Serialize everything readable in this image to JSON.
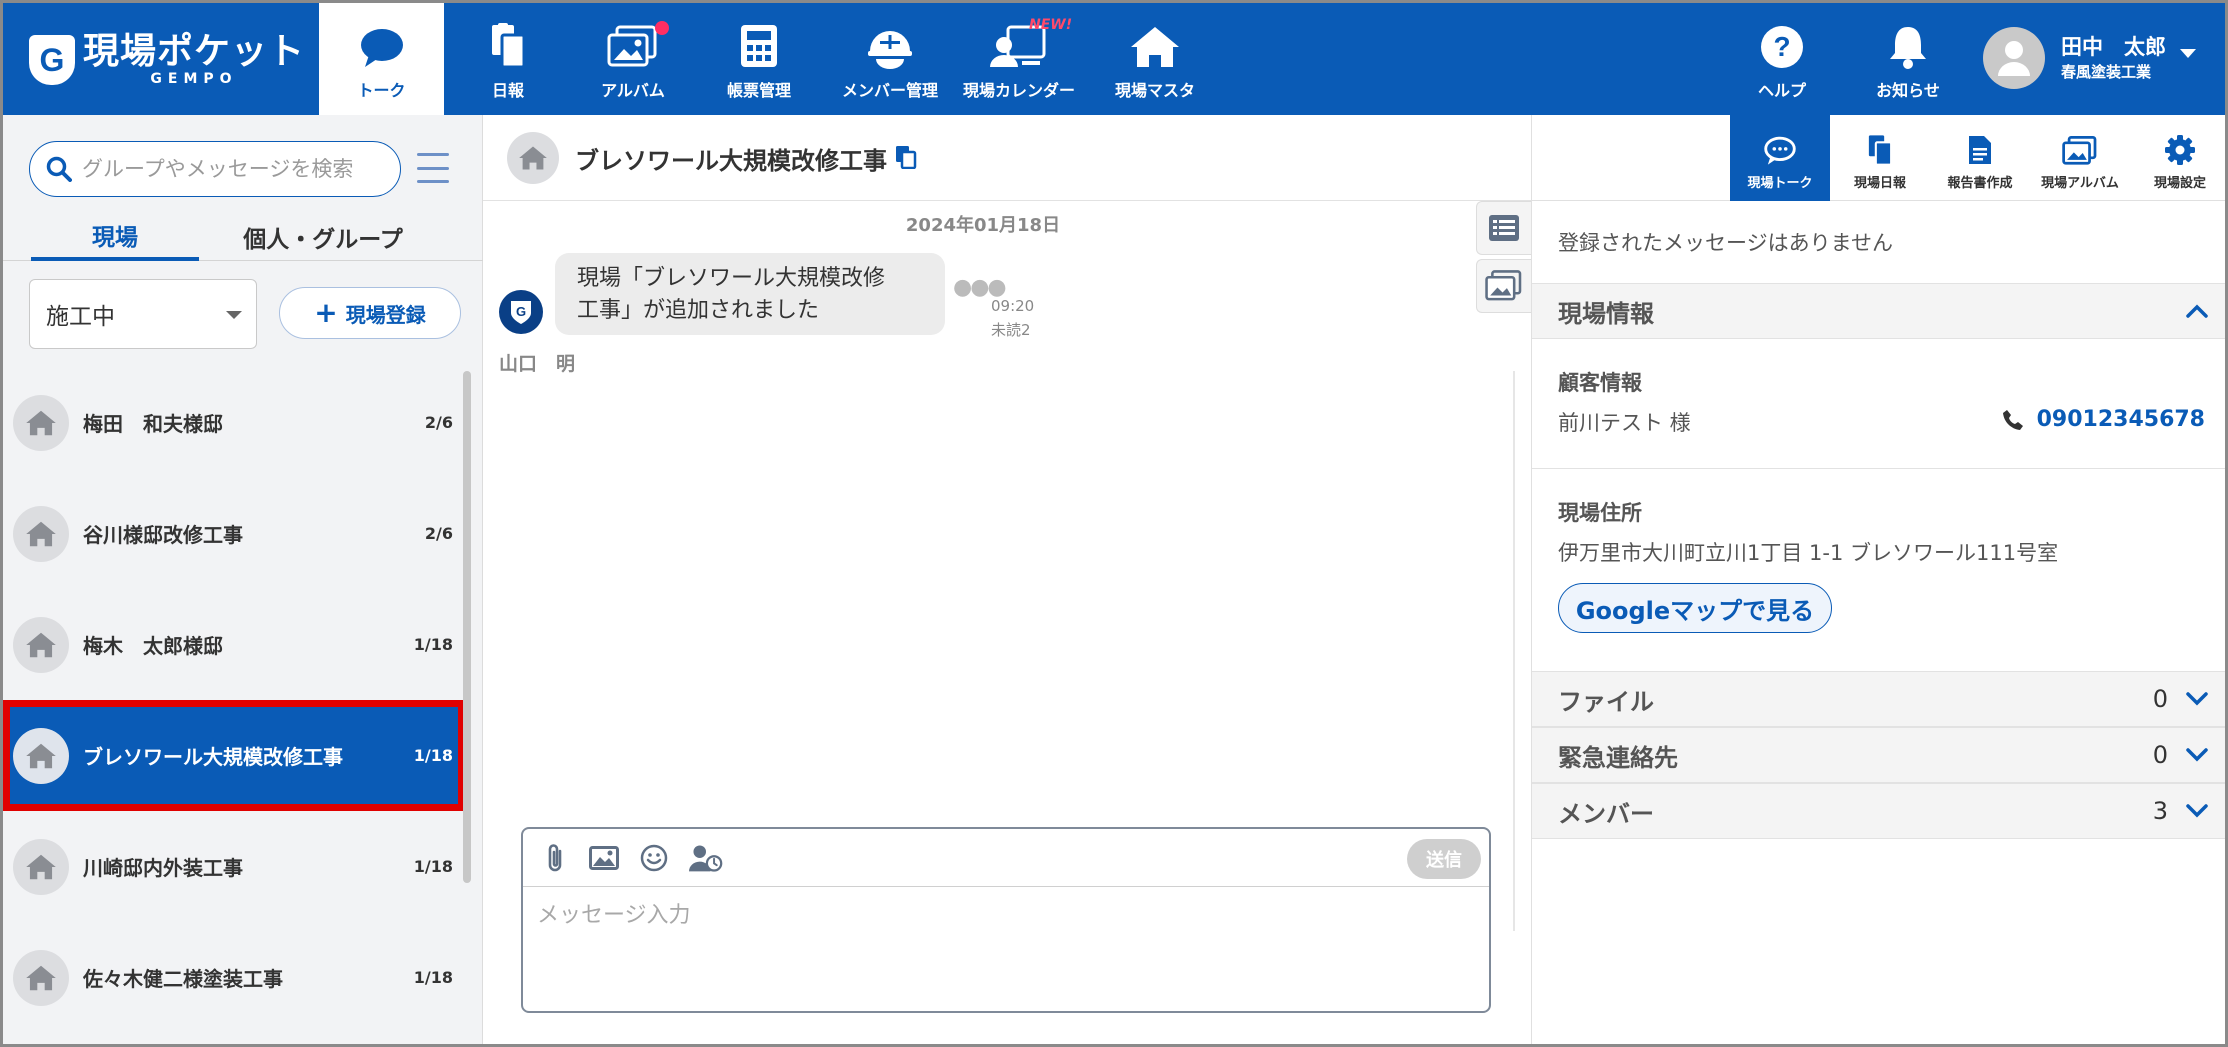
{
  "app": {
    "logo_main": "現場ポケット",
    "logo_sub": "GEMPO"
  },
  "nav": {
    "items": [
      {
        "label": "トーク",
        "icon": "chat-bubble-icon",
        "active": true
      },
      {
        "label": "日報",
        "icon": "daily-report-icon"
      },
      {
        "label": "アルバム",
        "icon": "album-icon"
      },
      {
        "label": "帳票管理",
        "icon": "calculator-icon"
      },
      {
        "label": "メンバー管理",
        "icon": "helmet-icon"
      },
      {
        "label": "現場カレンダー",
        "icon": "calendar-icon"
      },
      {
        "label": "現場マスタ",
        "icon": "house-icon"
      }
    ],
    "new_badge": "NEW!",
    "help_label": "ヘルプ",
    "notice_label": "お知らせ"
  },
  "user": {
    "name": "田中　太郎",
    "company": "春風塗装工業"
  },
  "sidebar": {
    "search_placeholder": "グループやメッセージを検索",
    "tab_site": "現場",
    "tab_group": "個人・グループ",
    "status_value": "施工中",
    "add_site_label": "現場登録",
    "sites": [
      {
        "name": "梅田　和夫様邸",
        "count": "2/6"
      },
      {
        "name": "谷川様邸改修工事",
        "count": "2/6"
      },
      {
        "name": "梅木　太郎様邸",
        "count": "1/18"
      },
      {
        "name": "ブレソワール大規模改修工事",
        "count": "1/18",
        "selected": true
      },
      {
        "name": "川崎邸内外装工事",
        "count": "1/18"
      },
      {
        "name": "佐々木健二様塗装工事",
        "count": "1/18"
      }
    ]
  },
  "chat": {
    "title": "ブレソワール大規模改修工事",
    "date": "2024年01月18日",
    "message_line1": "現場「ブレソワール大規模改修",
    "message_line2": "工事」が追加されました",
    "time": "09:20",
    "read_status": "未読2",
    "sender": "山口　明",
    "input_placeholder": "メッセージ入力",
    "send_label": "送信"
  },
  "right_panel": {
    "tabs": [
      {
        "label": "現場トーク",
        "active": true
      },
      {
        "label": "現場日報"
      },
      {
        "label": "報告書作成"
      },
      {
        "label": "現場アルバム"
      },
      {
        "label": "現場設定"
      }
    ],
    "no_messages": "登録されたメッセージはありません",
    "site_info_title": "現場情報",
    "customer_label": "顧客情報",
    "customer_name": "前川テスト 様",
    "phone": "09012345678",
    "address_label": "現場住所",
    "address": "伊万里市大川町立川1丁目 1-1 ブレソワール111号室",
    "map_button": "Googleマップで見る",
    "sections": [
      {
        "title": "ファイル",
        "count": "0"
      },
      {
        "title": "緊急連絡先",
        "count": "0"
      },
      {
        "title": "メンバー",
        "count": "3"
      }
    ]
  },
  "colors": {
    "brand": "#0a5bb6",
    "highlight": "#e00000",
    "new_badge": "#ff4a6b"
  }
}
